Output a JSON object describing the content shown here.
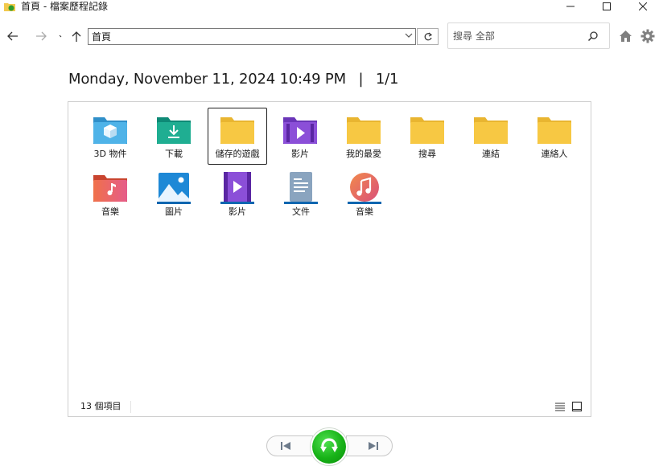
{
  "window": {
    "title": "首頁 - 檔案歷程記錄"
  },
  "nav": {
    "address": "首頁",
    "search_placeholder": "搜尋 全部"
  },
  "header": {
    "date": "Monday, November 11, 2024 10:49 PM",
    "separator": "|",
    "page": "1/1"
  },
  "items": [
    {
      "label": "3D 物件",
      "icon": "3d-objects-folder-icon"
    },
    {
      "label": "下載",
      "icon": "downloads-folder-icon"
    },
    {
      "label": "儲存的遊戲",
      "icon": "folder-icon",
      "selected": true
    },
    {
      "label": "影片",
      "icon": "videos-folder-icon"
    },
    {
      "label": "我的最愛",
      "icon": "folder-icon"
    },
    {
      "label": "搜尋",
      "icon": "folder-icon"
    },
    {
      "label": "連結",
      "icon": "folder-icon"
    },
    {
      "label": "連絡人",
      "icon": "folder-icon"
    },
    {
      "label": "音樂",
      "icon": "music-folder-icon"
    },
    {
      "label": "圖片",
      "icon": "pictures-library-icon"
    },
    {
      "label": "影片",
      "icon": "videos-library-icon"
    },
    {
      "label": "文件",
      "icon": "documents-library-icon"
    },
    {
      "label": "音樂",
      "icon": "music-library-icon"
    }
  ],
  "status": {
    "count": "13 個項目"
  },
  "colors": {
    "folder_yellow": "#f7c843",
    "restore_green": "#17b217"
  }
}
